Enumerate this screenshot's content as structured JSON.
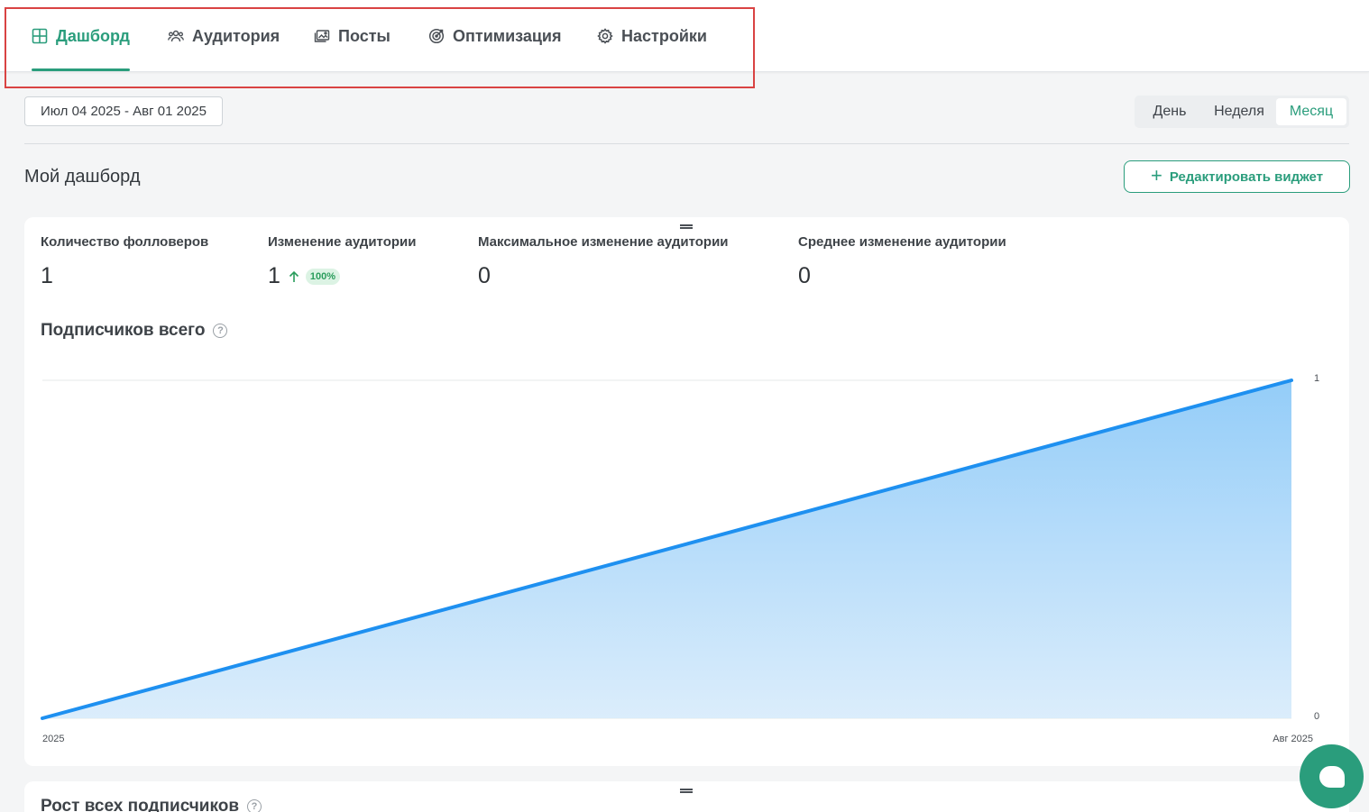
{
  "nav": {
    "tabs": [
      {
        "label": "Дашборд",
        "icon": "grid-icon",
        "active": true
      },
      {
        "label": "Аудитория",
        "icon": "users-icon",
        "active": false
      },
      {
        "label": "Посты",
        "icon": "images-icon",
        "active": false
      },
      {
        "label": "Оптимизация",
        "icon": "target-icon",
        "active": false
      },
      {
        "label": "Настройки",
        "icon": "gear-icon",
        "active": false
      }
    ]
  },
  "filters": {
    "date_range": "Июл 04 2025 - Авг 01 2025",
    "periods": [
      "День",
      "Неделя",
      "Месяц"
    ],
    "active_period": "Месяц"
  },
  "dashboard": {
    "title": "Мой дашборд",
    "edit_widget_label": "Редактировать виджет"
  },
  "metrics": [
    {
      "label": "Количество фолловеров",
      "value": "1"
    },
    {
      "label": "Изменение аудитории",
      "value": "1",
      "badge": "100%"
    },
    {
      "label": "Максимальное изменение аудитории",
      "value": "0"
    },
    {
      "label": "Среднее изменение аудитории",
      "value": "0"
    }
  ],
  "chart": {
    "title": "Подписчиков всего",
    "help": "?"
  },
  "chart_data": {
    "type": "area",
    "x": [
      "2025",
      "Авг 2025"
    ],
    "values": [
      0,
      1
    ],
    "y_ticks": [
      "1",
      "0"
    ],
    "ylim": [
      0,
      1
    ],
    "y_axis_position": "right",
    "grid": true,
    "color": "#1e90f0",
    "fill_color": "#a9d7fb"
  },
  "second_card": {
    "title": "Рост всех подписчиков"
  },
  "colors": {
    "accent": "#2a9d7c",
    "highlight": "#d94343"
  }
}
